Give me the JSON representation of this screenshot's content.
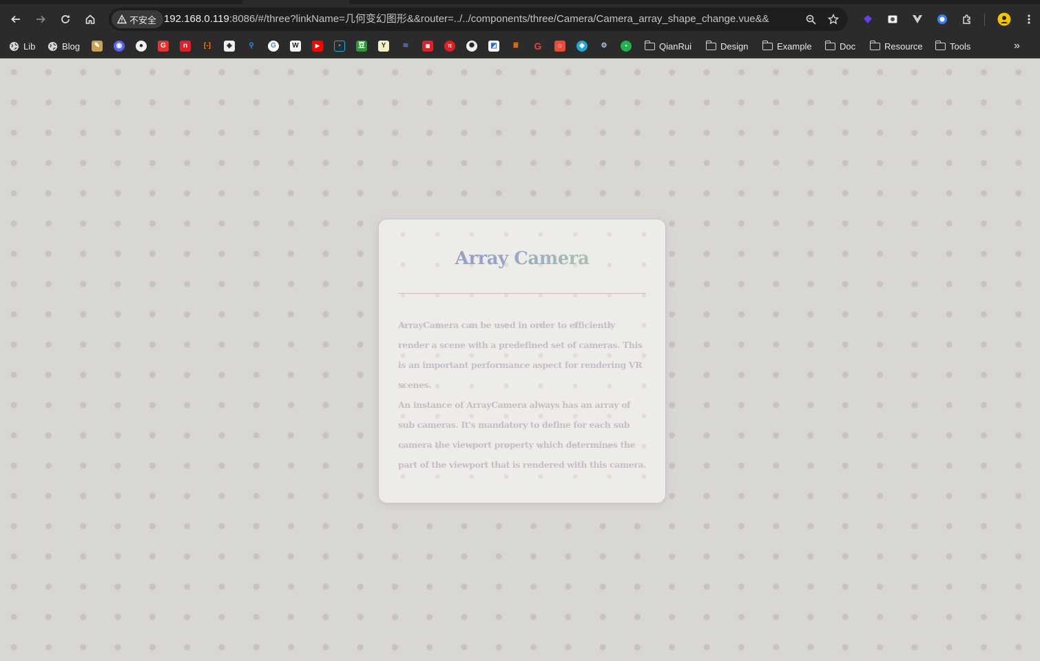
{
  "browser": {
    "security_label": "不安全",
    "url_host": "192.168.0.119",
    "url_rest": ":8086/#/three?linkName=几何变幻图形&&router=../../components/three/Camera/Camera_array_shape_change.vue&&",
    "bookmarks": {
      "lib": "Lib",
      "blog": "Blog",
      "folders": [
        "QianRui",
        "Design",
        "Example",
        "Doc",
        "Resource",
        "Tools"
      ]
    }
  },
  "card": {
    "title": "Array Camera",
    "paragraph_1": "ArrayCamera can be used in order to efficiently render a scene with a predefined set of cameras. This is an important performance aspect for rendering VR scenes.",
    "paragraph_2": "An instance of ArrayCamera always has an array of sub cameras. It's mandatory to define for each sub camera the viewport property which determines the part of the viewport that is rendered with this camera."
  }
}
